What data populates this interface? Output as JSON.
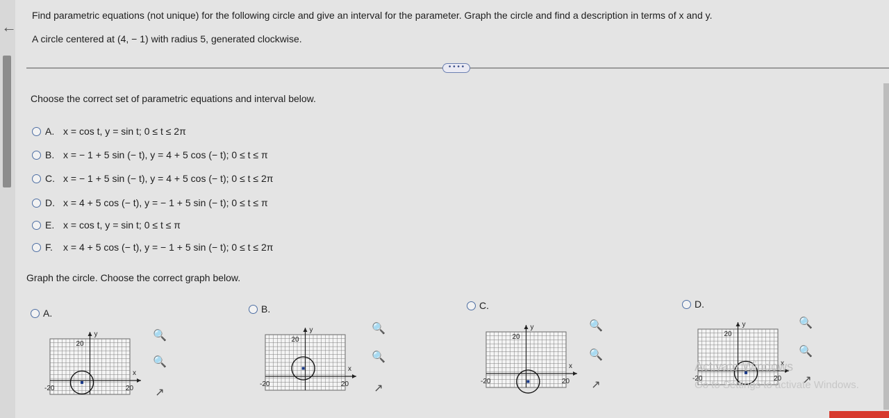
{
  "problem_text": "Find parametric equations (not unique) for the following circle and give an interval for the parameter. Graph the circle and find a description in terms of x and y.",
  "given_text": "A circle centered at (4, − 1) with radius 5, generated clockwise.",
  "more_label": "• • • •",
  "question_text": "Choose the correct set of parametric equations and interval below.",
  "options": [
    {
      "letter": "A.",
      "text": "x = cos t, y = sin t; 0 ≤ t ≤ 2π"
    },
    {
      "letter": "B.",
      "text": "x = − 1 + 5 sin (− t), y = 4 + 5 cos (− t); 0 ≤ t ≤ π"
    },
    {
      "letter": "C.",
      "text": "x = − 1 + 5 sin (− t), y = 4 + 5 cos (− t); 0 ≤ t ≤ 2π"
    },
    {
      "letter": "D.",
      "text": "x = 4 + 5 cos (− t), y = − 1 + 5 sin (− t); 0 ≤ t ≤ π"
    },
    {
      "letter": "E.",
      "text": "x = cos t, y = sin t; 0 ≤ t ≤ π"
    },
    {
      "letter": "F.",
      "text": "x = 4 + 5 cos (− t), y = − 1 + 5 sin (− t); 0 ≤ t ≤ 2π"
    }
  ],
  "graph_question": "Graph the circle. Choose the correct graph below.",
  "graph_options": [
    {
      "letter": "A.",
      "y_label": "y",
      "x_label": "x",
      "y_tick": "20",
      "x_tick_neg": "-20",
      "x_tick_pos": "20"
    },
    {
      "letter": "B.",
      "y_label": "y",
      "x_label": "x",
      "y_tick": "20",
      "x_tick_neg": "-20",
      "x_tick_pos": "20"
    },
    {
      "letter": "C.",
      "y_label": "y",
      "x_label": "x",
      "y_tick": "20",
      "x_tick_neg": "-20",
      "x_tick_pos": "20"
    },
    {
      "letter": "D.",
      "y_label": "y",
      "x_label": "x",
      "y_tick": "20",
      "x_tick_neg": "-20",
      "x_tick_pos": "20"
    }
  ],
  "watermark": {
    "line1": "Activate Windows",
    "line2": "Go to Settings to activate Windows."
  },
  "icons": {
    "zoom_in": "zoom-in-icon",
    "zoom_out": "zoom-out-icon",
    "popout": "external-link-icon",
    "back": "back-arrow-icon"
  },
  "colors": {
    "radio_border": "#4d6ea3",
    "circle": "#1a3a8a",
    "grid": "#7d7d7d"
  }
}
